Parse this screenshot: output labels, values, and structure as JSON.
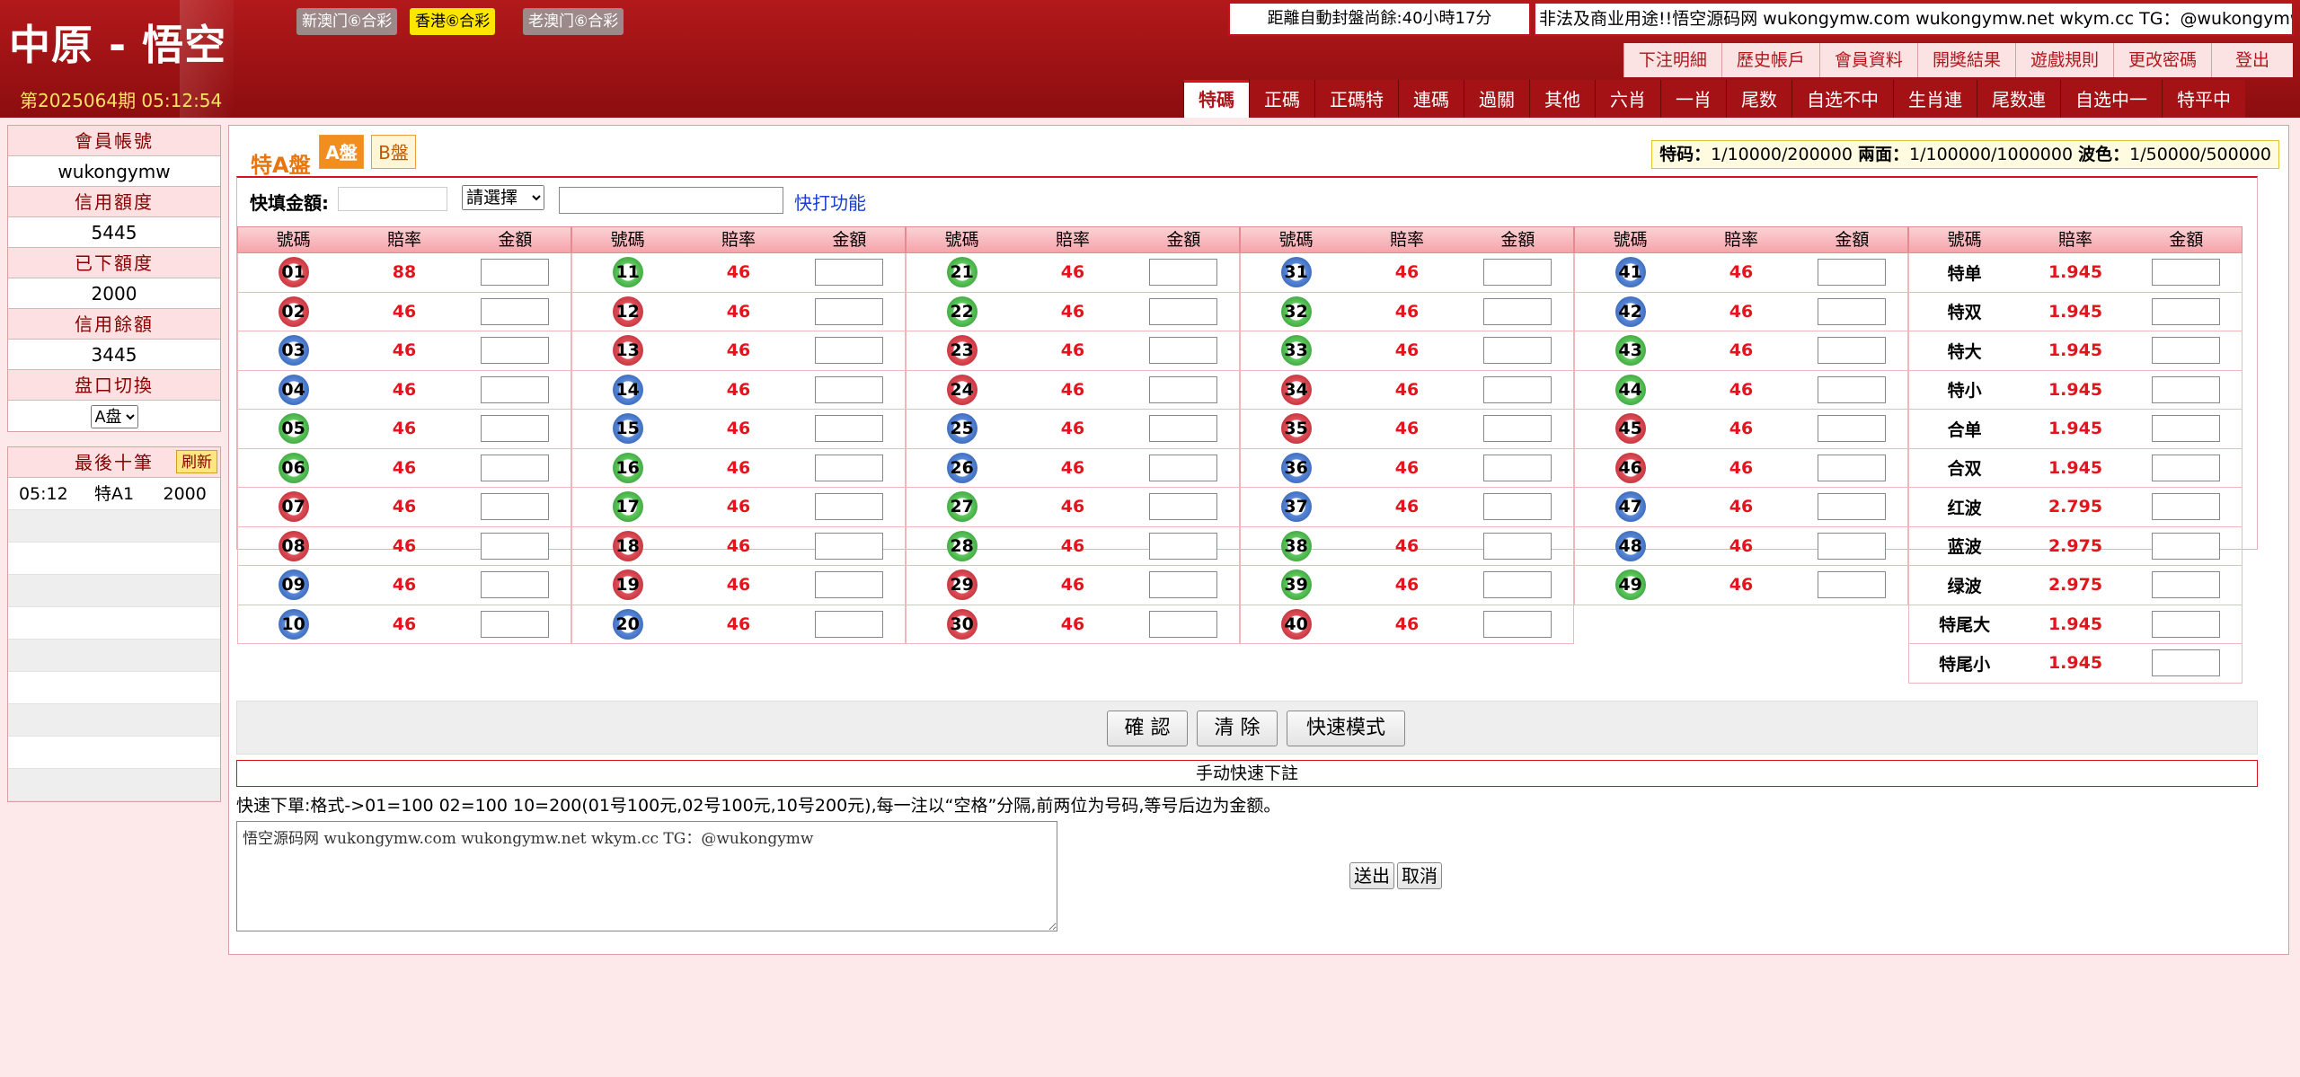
{
  "header": {
    "logo": "中原 - 悟空",
    "period": "第2025064期 05:12:54",
    "lottery_tabs": [
      {
        "label": "新澳门⑥合彩",
        "active": false
      },
      {
        "label": "香港⑥合彩",
        "active": true
      },
      {
        "label": "老澳门⑥合彩",
        "active": false
      }
    ],
    "countdown": "距離自動封盤尚餘:40小時17分",
    "marquee": "非法及商业用途!!悟空源码网 wukongymw.com wukongymw.net wkym.cc TG：@wukongymw",
    "top_links": [
      "下注明細",
      "歷史帳戶",
      "會員資料",
      "開獎結果",
      "遊戲規則",
      "更改密碼",
      "登出"
    ],
    "nav_tabs": [
      "特碼",
      "正碼",
      "正碼特",
      "連碼",
      "過關",
      "其他",
      "六肖",
      "一肖",
      "尾数",
      "自选不中",
      "生肖連",
      "尾数連",
      "自选中一",
      "特平中"
    ],
    "nav_active": "特碼"
  },
  "sidebar": {
    "account_label": "會員帳號",
    "account": "wukongymw",
    "credit_label": "信用額度",
    "credit": "5445",
    "placed_label": "已下額度",
    "placed": "2000",
    "balance_label": "信用餘額",
    "balance": "3445",
    "switch_label": "盘口切換",
    "switch_value": "A盘",
    "recent_label": "最後十筆",
    "refresh_label": "刷新",
    "recent": [
      {
        "time": "05:12",
        "type": "特A1",
        "amount": "2000"
      }
    ]
  },
  "main": {
    "title": "特A盤",
    "pan_a": "A盤",
    "pan_b": "B盤",
    "limits": [
      {
        "label": "特码：",
        "value": "1/10000/200000"
      },
      {
        "label": "兩面：",
        "value": "1/100000/1000000"
      },
      {
        "label": "波色：",
        "value": "1/50000/500000"
      }
    ],
    "quick_label": "快填金額:",
    "quick_select": "請選擇",
    "quick_link": "快打功能",
    "col_headers": [
      "號碼",
      "賠率",
      "金額"
    ],
    "numbers": [
      {
        "n": "01",
        "c": "r",
        "odds": "88"
      },
      {
        "n": "02",
        "c": "r",
        "odds": "46"
      },
      {
        "n": "03",
        "c": "b",
        "odds": "46"
      },
      {
        "n": "04",
        "c": "b",
        "odds": "46"
      },
      {
        "n": "05",
        "c": "g",
        "odds": "46"
      },
      {
        "n": "06",
        "c": "g",
        "odds": "46"
      },
      {
        "n": "07",
        "c": "r",
        "odds": "46"
      },
      {
        "n": "08",
        "c": "r",
        "odds": "46"
      },
      {
        "n": "09",
        "c": "b",
        "odds": "46"
      },
      {
        "n": "10",
        "c": "b",
        "odds": "46"
      },
      {
        "n": "11",
        "c": "g",
        "odds": "46"
      },
      {
        "n": "12",
        "c": "r",
        "odds": "46"
      },
      {
        "n": "13",
        "c": "r",
        "odds": "46"
      },
      {
        "n": "14",
        "c": "b",
        "odds": "46"
      },
      {
        "n": "15",
        "c": "b",
        "odds": "46"
      },
      {
        "n": "16",
        "c": "g",
        "odds": "46"
      },
      {
        "n": "17",
        "c": "g",
        "odds": "46"
      },
      {
        "n": "18",
        "c": "r",
        "odds": "46"
      },
      {
        "n": "19",
        "c": "r",
        "odds": "46"
      },
      {
        "n": "20",
        "c": "b",
        "odds": "46"
      },
      {
        "n": "21",
        "c": "g",
        "odds": "46"
      },
      {
        "n": "22",
        "c": "g",
        "odds": "46"
      },
      {
        "n": "23",
        "c": "r",
        "odds": "46"
      },
      {
        "n": "24",
        "c": "r",
        "odds": "46"
      },
      {
        "n": "25",
        "c": "b",
        "odds": "46"
      },
      {
        "n": "26",
        "c": "b",
        "odds": "46"
      },
      {
        "n": "27",
        "c": "g",
        "odds": "46"
      },
      {
        "n": "28",
        "c": "g",
        "odds": "46"
      },
      {
        "n": "29",
        "c": "r",
        "odds": "46"
      },
      {
        "n": "30",
        "c": "r",
        "odds": "46"
      },
      {
        "n": "31",
        "c": "b",
        "odds": "46"
      },
      {
        "n": "32",
        "c": "g",
        "odds": "46"
      },
      {
        "n": "33",
        "c": "g",
        "odds": "46"
      },
      {
        "n": "34",
        "c": "r",
        "odds": "46"
      },
      {
        "n": "35",
        "c": "r",
        "odds": "46"
      },
      {
        "n": "36",
        "c": "b",
        "odds": "46"
      },
      {
        "n": "37",
        "c": "b",
        "odds": "46"
      },
      {
        "n": "38",
        "c": "g",
        "odds": "46"
      },
      {
        "n": "39",
        "c": "g",
        "odds": "46"
      },
      {
        "n": "40",
        "c": "r",
        "odds": "46"
      },
      {
        "n": "41",
        "c": "b",
        "odds": "46"
      },
      {
        "n": "42",
        "c": "b",
        "odds": "46"
      },
      {
        "n": "43",
        "c": "g",
        "odds": "46"
      },
      {
        "n": "44",
        "c": "g",
        "odds": "46"
      },
      {
        "n": "45",
        "c": "r",
        "odds": "46"
      },
      {
        "n": "46",
        "c": "r",
        "odds": "46"
      },
      {
        "n": "47",
        "c": "b",
        "odds": "46"
      },
      {
        "n": "48",
        "c": "b",
        "odds": "46"
      },
      {
        "n": "49",
        "c": "g",
        "odds": "46"
      }
    ],
    "specials": [
      {
        "label": "特单",
        "odds": "1.945"
      },
      {
        "label": "特双",
        "odds": "1.945"
      },
      {
        "label": "特大",
        "odds": "1.945"
      },
      {
        "label": "特小",
        "odds": "1.945"
      },
      {
        "label": "合单",
        "odds": "1.945"
      },
      {
        "label": "合双",
        "odds": "1.945"
      },
      {
        "label": "红波",
        "odds": "2.795"
      },
      {
        "label": "蓝波",
        "odds": "2.975"
      },
      {
        "label": "绿波",
        "odds": "2.975"
      },
      {
        "label": "特尾大",
        "odds": "1.945"
      },
      {
        "label": "特尾小",
        "odds": "1.945"
      }
    ],
    "confirm_btn": "確 認",
    "clear_btn": "清 除",
    "fast_btn": "快速模式",
    "manual_head": "手动快速下註",
    "manual_tip": "快速下單:格式->01=100 02=100 10=200(01号100元,02号100元,10号200元),每一注以“空格”分隔,前两位为号码,等号后边为金额。",
    "manual_text": "悟空源码网 wukongymw.com wukongymw.net wkym.cc TG：@wukongymw",
    "send_btn": "送出",
    "cancel_btn": "取消"
  },
  "colors": {
    "brand_red": "#b2191b",
    "odds_red": "#e4141c",
    "active_tab_yellow": "#ffe600"
  }
}
